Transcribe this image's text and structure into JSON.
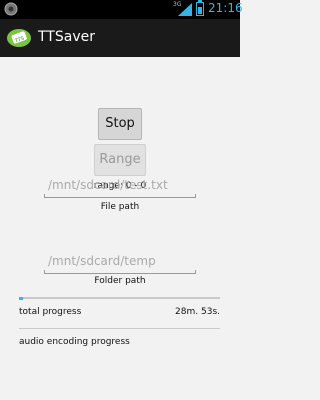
{
  "status_bar": {
    "network": "3G",
    "time": "21:16",
    "left_icon": "circle-icon",
    "battery_icon": "battery-icon",
    "signal_icon": "signal-icon"
  },
  "action_bar": {
    "title": "TTSaver",
    "app_icon": "ttsaver-logo-icon"
  },
  "controls": {
    "stop_label": "Stop",
    "range_label": "Range",
    "range_value": "range: 0 - 0"
  },
  "file_path": {
    "placeholder": "/mnt/sdcard/test.txt",
    "label": "File path"
  },
  "folder_path": {
    "placeholder": "/mnt/sdcard/temp",
    "label": "Folder path"
  },
  "progress": {
    "total_label": "total progress",
    "total_time": "28m. 53s.",
    "total_fraction": 0.02,
    "audio_label": "audio encoding progress"
  },
  "colors": {
    "accent": "#33b5e5",
    "action_bar": "#1a1a1a",
    "background": "#f2f2f2"
  }
}
